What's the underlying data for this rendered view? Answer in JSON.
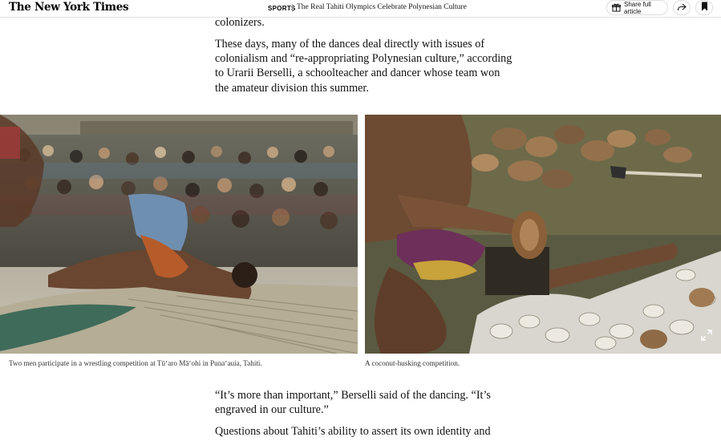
{
  "header": {
    "logo": "The New York Times",
    "section": "SPORTS",
    "headline": "The Real Tahiti Olympics Celebrate Polynesian Culture",
    "share_label": "Share full article"
  },
  "article": {
    "para_top_fragment": "colonizers.",
    "para_1": "These days, many of the dances deal directly with issues of colonialism and “re-appropriating Polynesian culture,” according to Urarii Berselli, a schoolteacher and dancer whose team won the amateur division this summer.",
    "para_2": "“It’s more than important,” Berselli said of the dancing. “It’s engraved in our culture.”",
    "para_3_fragment": "Questions about Tahiti’s ability to assert its own identity and"
  },
  "photos": {
    "left_caption": "Two men participate in a wrestling competition at Tū‘aro Mā‘ohi in Puna‘auia, Tahiti.",
    "right_caption": "A coconut-husking competition."
  },
  "icons": {
    "share_gift": "gift-icon",
    "share_arrow": "share-arrow-icon",
    "bookmark": "bookmark-icon",
    "expand": "expand-icon"
  }
}
